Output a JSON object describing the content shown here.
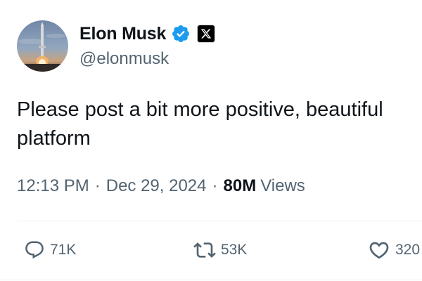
{
  "author": {
    "display_name": "Elon Musk",
    "handle": "@elonmusk",
    "verified": true,
    "affiliate_badge": "x-logo-badge"
  },
  "tweet": {
    "text_lines": [
      "Please post a bit more positive, beautiful",
      "platform"
    ]
  },
  "meta": {
    "time": "12:13 PM",
    "separator": "·",
    "date": "Dec 29, 2024",
    "views_count": "80M",
    "views_label": "Views"
  },
  "actions": {
    "replies": "71K",
    "retweets": "53K",
    "likes": "320"
  },
  "colors": {
    "text_primary": "#0f1419",
    "text_secondary": "#536471",
    "verified_blue": "#1d9bf0",
    "divider": "#eff3f4"
  },
  "icons": {
    "reply": "reply-icon",
    "retweet": "retweet-icon",
    "like": "heart-icon",
    "verified": "verified-badge-icon"
  }
}
